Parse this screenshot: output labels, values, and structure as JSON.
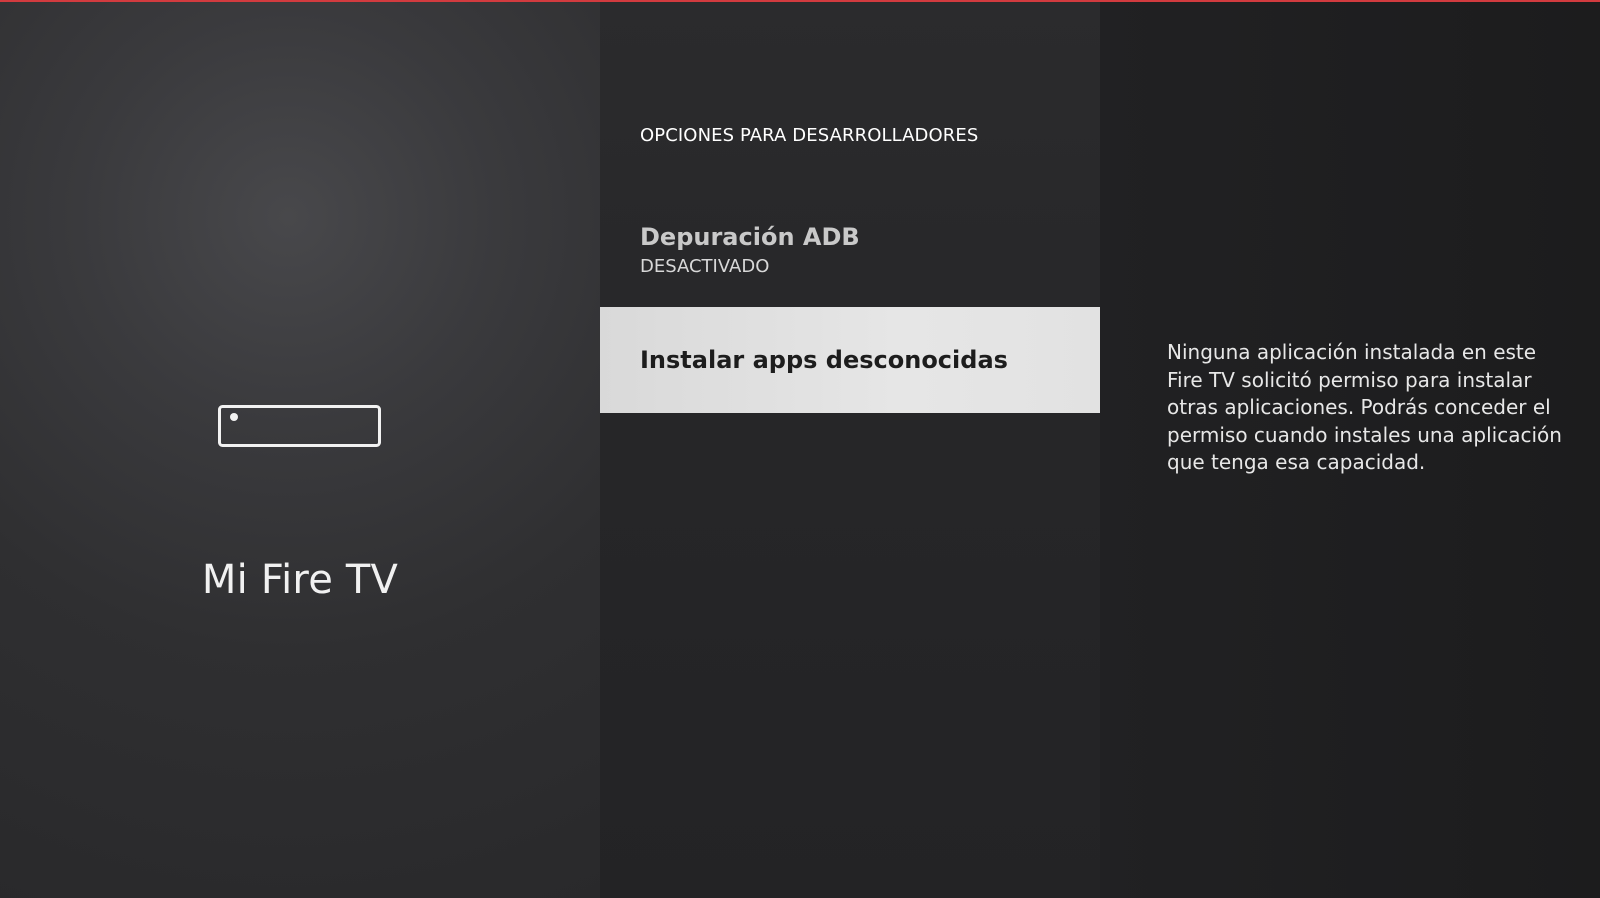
{
  "device": {
    "name": "Mi Fire TV",
    "icon": "fire-tv-device-icon"
  },
  "settings": {
    "section_title": "OPCIONES PARA DESARROLLADORES",
    "items": [
      {
        "label": "Depuración ADB",
        "value": "DESACTIVADO"
      },
      {
        "label": "Instalar apps desconocidas",
        "selected": true
      }
    ]
  },
  "help": {
    "description": "Ninguna aplicación instalada en este Fire TV solicitó permiso para instalar otras aplicaciones. Podrás conceder el permiso cuando instales una aplicación que tenga esa capacidad."
  },
  "colors": {
    "accent_line": "#d23b3f",
    "selected_item_background": "#e2e2e2",
    "dark_background": "#1c1c1d"
  }
}
